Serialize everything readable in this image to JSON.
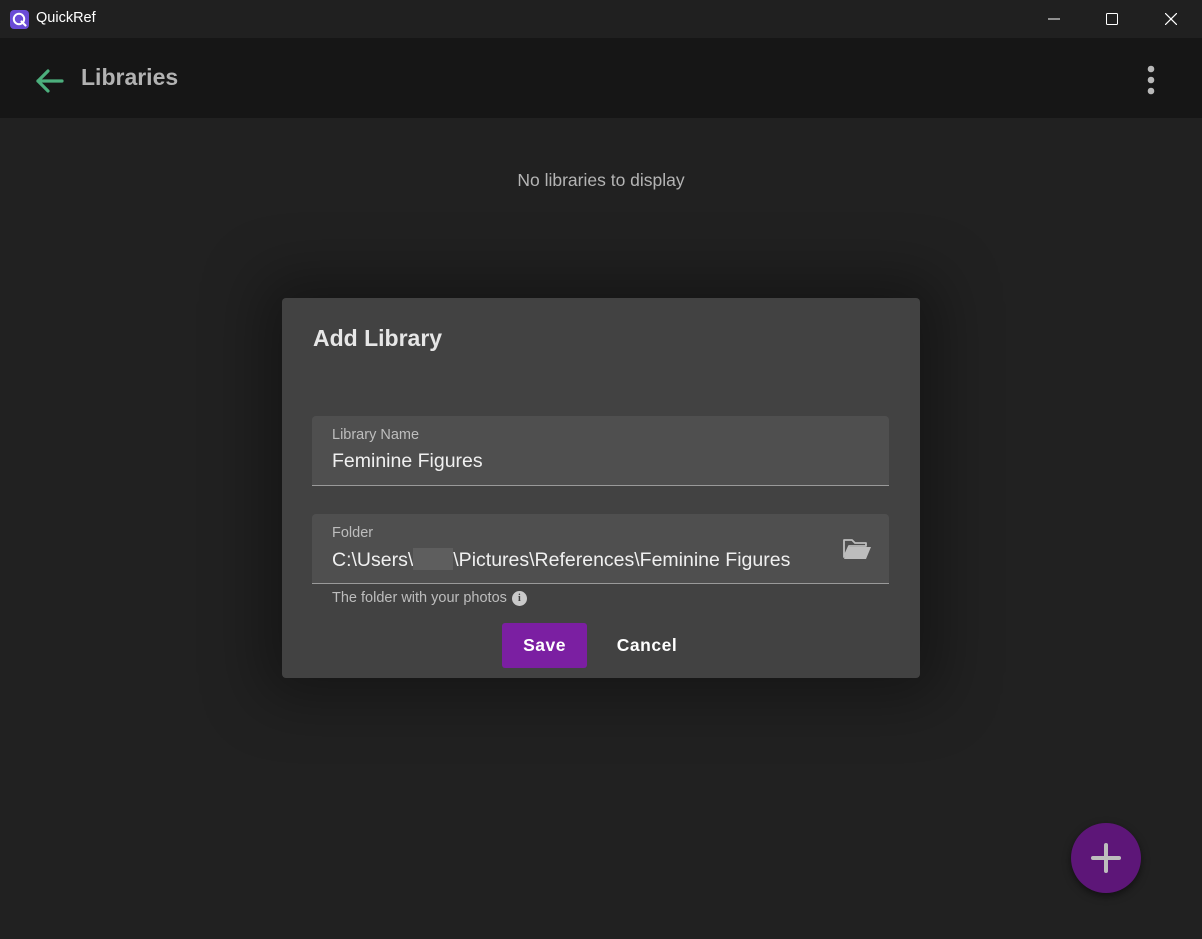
{
  "window": {
    "title": "QuickRef",
    "controls": [
      "minimize-icon",
      "maximize-icon",
      "close-icon"
    ]
  },
  "appbar": {
    "title": "Libraries",
    "back_icon": "arrow-left-icon",
    "menu_icon": "more-vertical-icon",
    "accent_color": "#4caf7d"
  },
  "main": {
    "empty_message": "No libraries to display"
  },
  "dialog": {
    "title": "Add Library",
    "name_field": {
      "label": "Library Name",
      "value": "Feminine Figures"
    },
    "folder_field": {
      "label": "Folder",
      "value_prefix": "C:\\Users\\",
      "value_suffix": "\\Pictures\\References\\Feminine Figures",
      "icon": "folder-open-icon",
      "helper": "The folder with your photos",
      "helper_icon": "info-icon"
    },
    "save_label": "Save",
    "cancel_label": "Cancel",
    "primary_color": "#7b1fa2"
  },
  "fab": {
    "icon": "plus-icon",
    "color": "#5d1678"
  }
}
